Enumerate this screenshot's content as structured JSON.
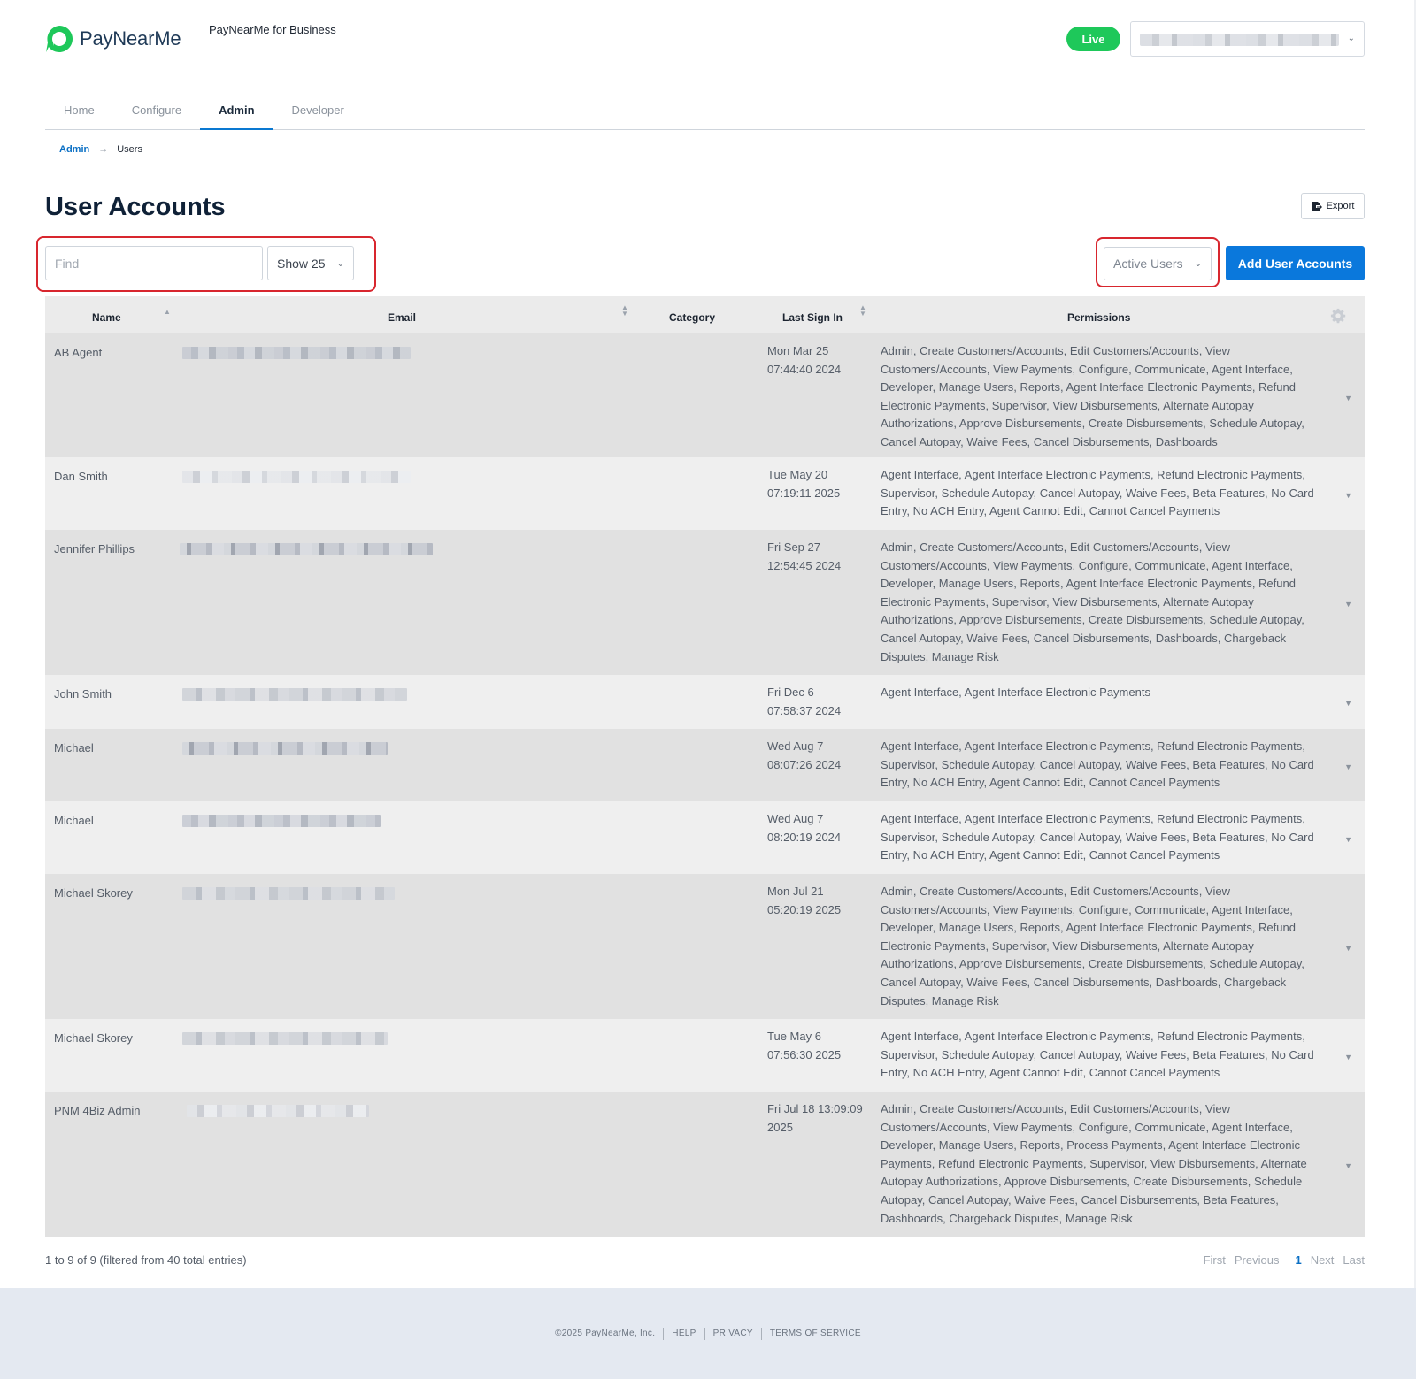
{
  "header": {
    "logo_text": "PayNearMe",
    "business_label": "PayNearMe for Business",
    "live_badge": "Live"
  },
  "tabs": [
    {
      "label": "Home"
    },
    {
      "label": "Configure"
    },
    {
      "label": "Admin"
    },
    {
      "label": "Developer"
    }
  ],
  "breadcrumb": {
    "parent": "Admin",
    "current": "Users"
  },
  "page_title": "User Accounts",
  "export_label": "Export",
  "controls": {
    "find_placeholder": "Find",
    "show_label": "Show 25",
    "status_filter": "Active Users",
    "add_button": "Add User Accounts"
  },
  "table": {
    "columns": [
      "Name",
      "Email",
      "Category",
      "Last Sign In",
      "Permissions"
    ],
    "rows": [
      {
        "name": "AB Agent",
        "date_line1": "Mon Mar 25",
        "date_line2": "07:44:40 2024",
        "permissions": "Admin, Create Customers/Accounts, Edit Customers/Accounts, View Customers/Accounts, View Payments, Configure, Communicate, Agent Interface, Developer, Manage Users, Reports, Agent Interface Electronic Payments, Refund Electronic Payments, Supervisor, View Disbursements, Alternate Autopay Authorizations, Approve Disbursements, Create Disbursements, Schedule Autopay, Cancel Autopay, Waive Fees, Cancel Disbursements, Dashboards"
      },
      {
        "name": "Dan Smith",
        "date_line1": "Tue May 20",
        "date_line2": "07:19:11 2025",
        "permissions": "Agent Interface, Agent Interface Electronic Payments, Refund Electronic Payments, Supervisor, Schedule Autopay, Cancel Autopay, Waive Fees, Beta Features, No Card Entry, No ACH Entry, Agent Cannot Edit, Cannot Cancel Payments"
      },
      {
        "name": "Jennifer Phillips",
        "date_line1": "Fri Sep 27",
        "date_line2": "12:54:45 2024",
        "permissions": "Admin, Create Customers/Accounts, Edit Customers/Accounts, View Customers/Accounts, View Payments, Configure, Communicate, Agent Interface, Developer, Manage Users, Reports, Agent Interface Electronic Payments, Refund Electronic Payments, Supervisor, View Disbursements, Alternate Autopay Authorizations, Approve Disbursements, Create Disbursements, Schedule Autopay, Cancel Autopay, Waive Fees, Cancel Disbursements, Dashboards, Chargeback Disputes, Manage Risk"
      },
      {
        "name": "John Smith",
        "date_line1": "Fri Dec 6",
        "date_line2": "07:58:37 2024",
        "permissions": "Agent Interface, Agent Interface Electronic Payments"
      },
      {
        "name": "Michael",
        "date_line1": "Wed Aug 7",
        "date_line2": "08:07:26 2024",
        "permissions": "Agent Interface, Agent Interface Electronic Payments, Refund Electronic Payments, Supervisor, Schedule Autopay, Cancel Autopay, Waive Fees, Beta Features, No Card Entry, No ACH Entry, Agent Cannot Edit, Cannot Cancel Payments"
      },
      {
        "name": "Michael",
        "date_line1": "Wed Aug 7",
        "date_line2": "08:20:19 2024",
        "permissions": "Agent Interface, Agent Interface Electronic Payments, Refund Electronic Payments, Supervisor, Schedule Autopay, Cancel Autopay, Waive Fees, Beta Features, No Card Entry, No ACH Entry, Agent Cannot Edit, Cannot Cancel Payments"
      },
      {
        "name": "Michael Skorey",
        "date_line1": "Mon Jul 21",
        "date_line2": "05:20:19 2025",
        "permissions": "Admin, Create Customers/Accounts, Edit Customers/Accounts, View Customers/Accounts, View Payments, Configure, Communicate, Agent Interface, Developer, Manage Users, Reports, Agent Interface Electronic Payments, Refund Electronic Payments, Supervisor, View Disbursements, Alternate Autopay Authorizations, Approve Disbursements, Create Disbursements, Schedule Autopay, Cancel Autopay, Waive Fees, Cancel Disbursements, Dashboards, Chargeback Disputes, Manage Risk"
      },
      {
        "name": "Michael Skorey",
        "date_line1": "Tue May 6",
        "date_line2": "07:56:30 2025",
        "permissions": "Agent Interface, Agent Interface Electronic Payments, Refund Electronic Payments, Supervisor, Schedule Autopay, Cancel Autopay, Waive Fees, Beta Features, No Card Entry, No ACH Entry, Agent Cannot Edit, Cannot Cancel Payments"
      },
      {
        "name": "PNM 4Biz Admin",
        "date_line1": "Fri Jul 18 13:09:09",
        "date_line2": "2025",
        "permissions": "Admin, Create Customers/Accounts, Edit Customers/Accounts, View Customers/Accounts, View Payments, Configure, Communicate, Agent Interface, Developer, Manage Users, Reports, Process Payments, Agent Interface Electronic Payments, Refund Electronic Payments, Supervisor, View Disbursements, Alternate Autopay Authorizations, Approve Disbursements, Create Disbursements, Schedule Autopay, Cancel Autopay, Waive Fees, Cancel Disbursements, Beta Features, Dashboards, Chargeback Disputes, Manage Risk"
      }
    ]
  },
  "table_info": "1 to 9 of 9 (filtered from 40 total entries)",
  "pagination": {
    "first": "First",
    "previous": "Previous",
    "current": "1",
    "next": "Next",
    "last": "Last"
  },
  "footer": {
    "copyright": "©2025 PayNearMe, Inc.",
    "help": "HELP",
    "privacy": "PRIVACY",
    "terms": "TERMS OF SERVICE"
  },
  "colors": {
    "brand_green": "#1ec85a",
    "primary_blue": "#0a78dc",
    "highlight_red": "#d8262e"
  }
}
